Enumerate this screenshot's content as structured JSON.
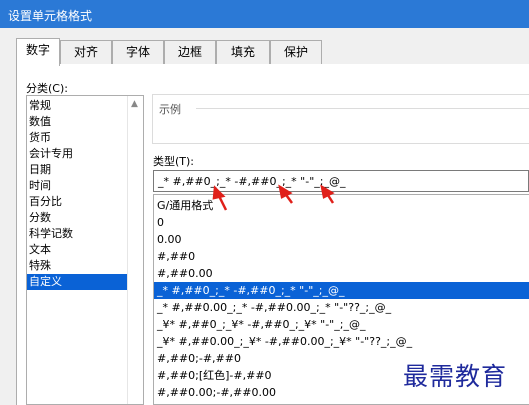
{
  "window": {
    "title": "设置单元格格式"
  },
  "tabs": [
    {
      "label": "数字",
      "active": true
    },
    {
      "label": "对齐",
      "active": false
    },
    {
      "label": "字体",
      "active": false
    },
    {
      "label": "边框",
      "active": false
    },
    {
      "label": "填充",
      "active": false
    },
    {
      "label": "保护",
      "active": false
    }
  ],
  "category": {
    "label": "分类(C):",
    "items": [
      "常规",
      "数值",
      "货币",
      "会计专用",
      "日期",
      "时间",
      "百分比",
      "分数",
      "科学记数",
      "文本",
      "特殊",
      "自定义"
    ],
    "selected": "自定义"
  },
  "sample": {
    "label": "示例"
  },
  "type": {
    "label": "类型(T):",
    "value": "_* #,##0_;_* -#,##0_;_* \"-\"_;_@_",
    "formats": [
      "G/通用格式",
      "0",
      "0.00",
      "#,##0",
      "#,##0.00",
      "_* #,##0_;_* -#,##0_;_* \"-\"_;_@_",
      "_* #,##0.00_;_* -#,##0.00_;_* \"-\"??_;_@_",
      "_¥* #,##0_;_¥* -#,##0_;_¥* \"-\"_;_@_",
      "_¥* #,##0.00_;_¥* -#,##0.00_;_¥* \"-\"??_;_@_",
      "#,##0;-#,##0",
      "#,##0;[红色]-#,##0",
      "#,##0.00;-#,##0.00"
    ],
    "selected_index": 5
  },
  "watermark": {
    "text": "最需教育"
  },
  "colors": {
    "titlebar": "#2b79d6",
    "selection": "#0a62d6",
    "arrow": "#e0201a"
  }
}
